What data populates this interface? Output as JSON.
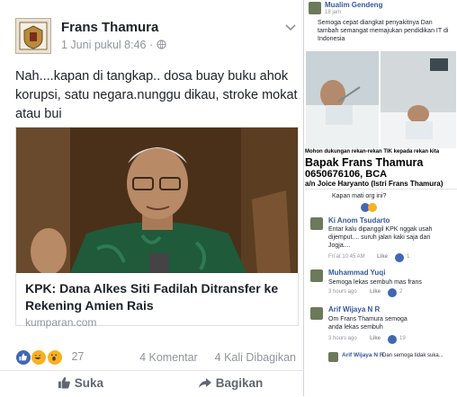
{
  "post": {
    "author": "Frans Thamura",
    "date": "1 Juni pukul 8:46 · ",
    "globe_icon": "globe-icon",
    "text": "Nah....kapan di tangkap.. dosa buay buku ahok korupsi, satu negara.nunggu dikau, stroke mokat atau bui",
    "link": {
      "title": "KPK: Dana Alkes Siti Fadilah Ditransfer ke Rekening Amien Rais",
      "domain": "kumparan.com"
    },
    "reactions_count": "27",
    "comments": "4 Komentar",
    "shares": "4 Kali Dibagikan",
    "like_label": "Suka",
    "share_label": "Bagikan"
  },
  "mobile": {
    "top": {
      "name": "Mualim Gendeng",
      "time": "18 jam",
      "text": "Semoga cepat diangkat penyakitnya Dan tambah semangat memajukan pendidikan IT di Indonesia"
    },
    "banner_small": "Mohon dukungan rekan-rekan TIK kepada rekan kita",
    "banner_name": "Bapak Frans Thamura",
    "banner_account": "0650676106, BCA",
    "banner_holder": "a/n Joice Haryanto (Istri Frans Thamura)",
    "comments": [
      {
        "name": "",
        "text": "Kapan mati org ini?",
        "time": "",
        "like": "",
        "count": ""
      },
      {
        "name": "Ki Anom Tsudarto",
        "text": "Entar kalu dipanggil KPK nggak usah dijemput.... suruh jalan kaki saja dari Jogja....",
        "time": "Fri at 10:45 AM",
        "like": "Like",
        "count": "1"
      },
      {
        "name": "Muhammad Yuqi",
        "text": "Semoga lekas sembuh mas frans",
        "time": "3 hours ago",
        "like": "Like",
        "count": "2"
      },
      {
        "name": "Arif Wijaya N R",
        "text": "Om Frans Thamura semoga anda lekas sembuh",
        "time": "3 hours ago",
        "like": "Like",
        "count": "19"
      },
      {
        "name": "Arif Wijaya N R",
        "text": "Dan semoga tidak suka...",
        "time": "",
        "like": "",
        "count": ""
      }
    ]
  }
}
